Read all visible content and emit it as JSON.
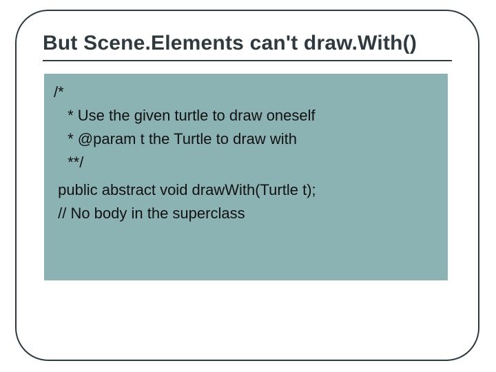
{
  "title": "But Scene.Elements can't draw.With()",
  "code": {
    "l1": "/*",
    "l2": " * Use the given turtle to draw oneself",
    "l3": " * @param t the Turtle to draw with",
    "l4": " **/",
    "l5": " public abstract void drawWith(Turtle t);",
    "l6": " // No body in the superclass"
  }
}
